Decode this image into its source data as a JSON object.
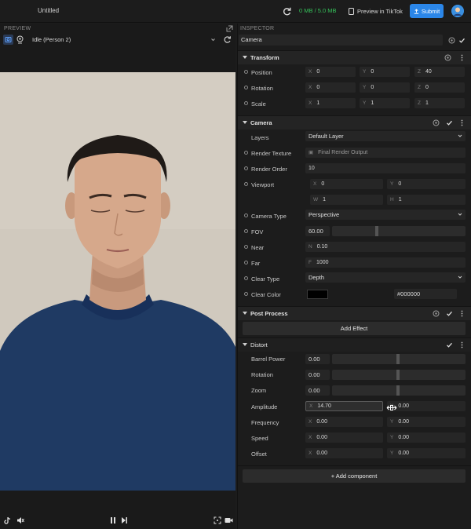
{
  "topbar": {
    "title": "Untitled",
    "memory": "0 MB / 5.0 MB",
    "preview_tiktok": "Preview in TikTok",
    "submit": "Submit",
    "accent": "#2b86e8",
    "memory_color": "#35c35a"
  },
  "preview": {
    "header": "PREVIEW",
    "preset": "Idle (Person 2)"
  },
  "inspector": {
    "header": "INSPECTOR",
    "object_name": "Camera",
    "transform": {
      "title": "Transform",
      "position_label": "Position",
      "position": {
        "x": "0",
        "y": "0",
        "z": "40"
      },
      "rotation_label": "Rotation",
      "rotation": {
        "x": "0",
        "y": "0",
        "z": "0"
      },
      "scale_label": "Scale",
      "scale": {
        "x": "1",
        "y": "1",
        "z": "1"
      }
    },
    "camera": {
      "title": "Camera",
      "layers_label": "Layers",
      "layers": "Default Layer",
      "render_texture_label": "Render Texture",
      "render_texture": "Final Render Output",
      "render_order_label": "Render Order",
      "render_order": "10",
      "viewport_label": "Viewport",
      "viewport": {
        "x": "0",
        "y": "0",
        "w": "1",
        "h": "1"
      },
      "camera_type_label": "Camera Type",
      "camera_type": "Perspective",
      "fov_label": "FOV",
      "fov": "60.00",
      "near_label": "Near",
      "near": "0.10",
      "far_label": "Far",
      "far": "1000",
      "clear_type_label": "Clear Type",
      "clear_type": "Depth",
      "clear_color_label": "Clear Color",
      "clear_color": "#000000"
    },
    "post_process": {
      "title": "Post Process",
      "add_effect": "Add Effect"
    },
    "distort": {
      "title": "Distort",
      "barrel_power_label": "Barrel Power",
      "barrel_power": "0.00",
      "rotation_label": "Rotation",
      "rotation": "0.00",
      "zoom_label": "Zoom",
      "zoom": "0.00",
      "amplitude_label": "Amplitude",
      "amplitude": {
        "x": "14.70",
        "y": "0.00"
      },
      "frequency_label": "Frequency",
      "frequency": {
        "x": "0.00",
        "y": "0.00"
      },
      "speed_label": "Speed",
      "speed": {
        "x": "0.00",
        "y": "0.00"
      },
      "offset_label": "Offset",
      "offset": {
        "x": "0.00",
        "y": "0.00"
      }
    },
    "add_component": "+ Add component"
  },
  "axis_letters": {
    "x": "X",
    "y": "Y",
    "z": "Z",
    "w": "W",
    "h": "H",
    "n": "N",
    "f": "F"
  }
}
